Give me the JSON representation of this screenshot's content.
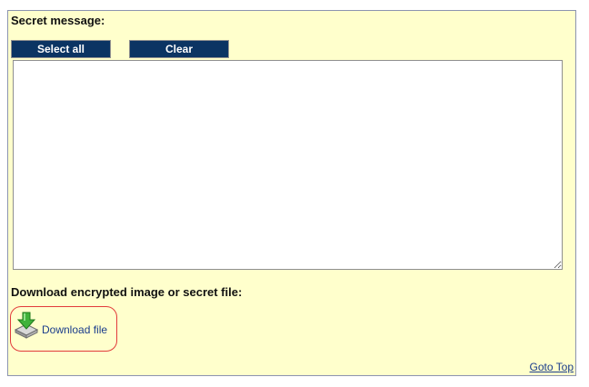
{
  "secret": {
    "label": "Secret message:",
    "select_all_label": "Select all",
    "clear_label": "Clear",
    "message_value": ""
  },
  "download": {
    "label": "Download encrypted image or secret file:",
    "link_label": "Download file",
    "icon": "download-icon"
  },
  "footer": {
    "goto_top_label": "Goto Top"
  },
  "colors": {
    "panel_bg": "#ffffcc",
    "button_bg": "#0b3463",
    "link": "#1a3c8c",
    "download_border": "#e23b3b"
  }
}
